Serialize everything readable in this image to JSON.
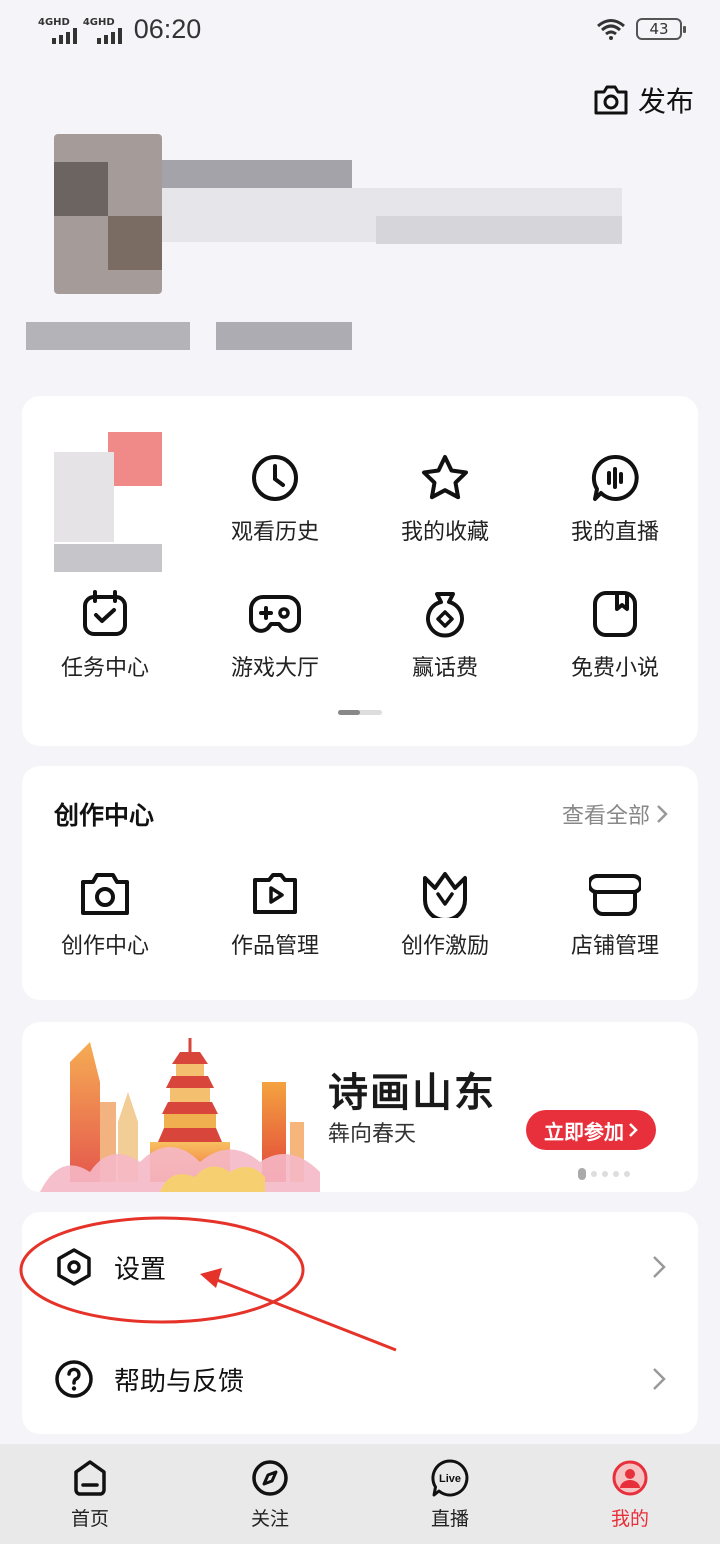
{
  "status_bar": {
    "network1": "4GHD",
    "network2": "4GHD",
    "time": "06:20",
    "battery": "43"
  },
  "header": {
    "publish_label": "发布",
    "publish_icon": "camera-icon"
  },
  "quick_grid": {
    "items": [
      {
        "label": "观看历史",
        "icon": "clock-icon"
      },
      {
        "label": "我的收藏",
        "icon": "star-icon"
      },
      {
        "label": "我的直播",
        "icon": "live-wave-icon"
      },
      {
        "label": "任务中心",
        "icon": "calendar-check-icon"
      },
      {
        "label": "游戏大厅",
        "icon": "gamepad-icon"
      },
      {
        "label": "赢话费",
        "icon": "money-bag-icon"
      },
      {
        "label": "免费小说",
        "icon": "book-icon"
      }
    ]
  },
  "creator": {
    "title": "创作中心",
    "see_all": "查看全部",
    "items": [
      {
        "label": "创作中心",
        "icon": "camera-icon"
      },
      {
        "label": "作品管理",
        "icon": "play-square-icon"
      },
      {
        "label": "创作激励",
        "icon": "crown-icon"
      },
      {
        "label": "店铺管理",
        "icon": "shop-icon"
      }
    ]
  },
  "banner": {
    "title": "诗画山东",
    "subtitle": "犇向春天",
    "button": "立即参加"
  },
  "menu": {
    "settings": "设置",
    "help": "帮助与反馈"
  },
  "tabbar": {
    "tabs": [
      {
        "label": "首页",
        "icon": "home-icon"
      },
      {
        "label": "关注",
        "icon": "compass-icon"
      },
      {
        "label": "直播",
        "icon": "live-icon"
      },
      {
        "label": "我的",
        "icon": "profile-icon"
      }
    ],
    "active": "我的"
  },
  "colors": {
    "accent": "#e8303c",
    "annotation": "#e5332a"
  }
}
